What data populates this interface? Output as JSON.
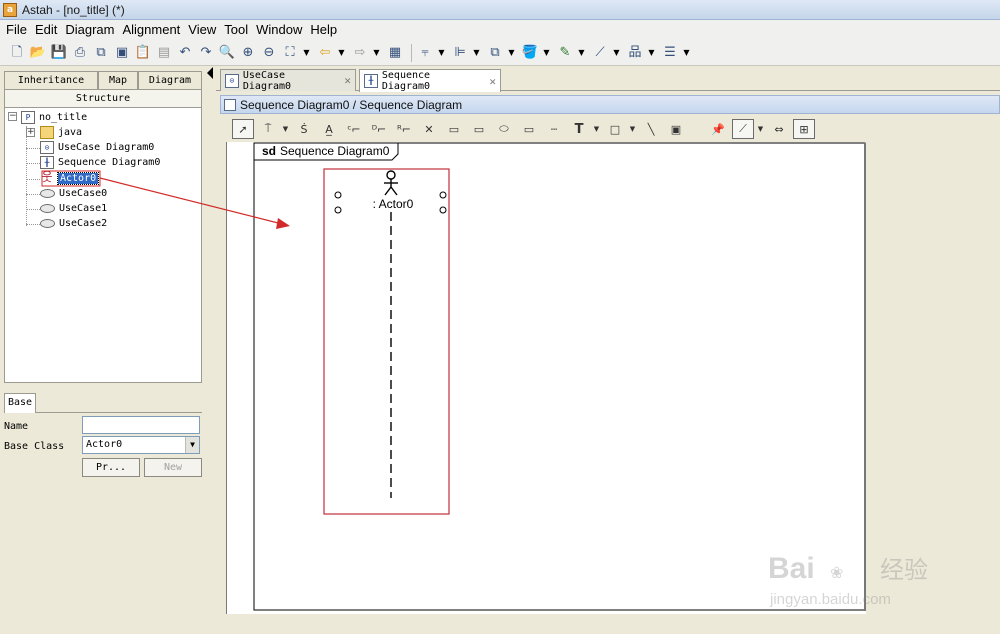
{
  "window": {
    "title": "Astah - [no_title] (*)",
    "app_icon": "astah-icon"
  },
  "menu": [
    "File",
    "Edit",
    "Diagram",
    "Alignment",
    "View",
    "Tool",
    "Window",
    "Help"
  ],
  "left_tabs": {
    "inheritance": "Inheritance",
    "map": "Map",
    "diagram": "Diagram",
    "structure": "Structure"
  },
  "tree": {
    "root": "no_title",
    "root_icon": "P",
    "items": [
      {
        "label": "java",
        "icon": "folder-icon"
      },
      {
        "label": "UseCase Diagram0",
        "icon": "usecase-diagram-icon"
      },
      {
        "label": "Sequence Diagram0",
        "icon": "sequence-diagram-icon"
      },
      {
        "label": "Actor0",
        "icon": "actor-icon",
        "selected": true
      },
      {
        "label": "UseCase0",
        "icon": "usecase-icon"
      },
      {
        "label": "UseCase1",
        "icon": "usecase-icon"
      },
      {
        "label": "UseCase2",
        "icon": "usecase-icon"
      }
    ]
  },
  "props": {
    "tab": "Base",
    "name_label": "Name",
    "name_value": "",
    "base_class_label": "Base Class",
    "base_class_value": "Actor0",
    "pr_button": "Pr...",
    "new_button": "New"
  },
  "diagram_tabs": [
    {
      "label": "UseCase Diagram0",
      "active": false
    },
    {
      "label": "Sequence Diagram0",
      "active": true
    }
  ],
  "breadcrumb": "Sequence Diagram0 / Sequence Diagram",
  "diagram": {
    "frame_keyword": "sd",
    "frame_name": "Sequence Diagram0",
    "lifeline_label": ": Actor0",
    "selection_color": "#c0303a",
    "annotation_color": "#d22a2a"
  },
  "watermark": {
    "brand": "Bai",
    "brand_cn": "经验",
    "site": "jingyan.baidu.com"
  }
}
